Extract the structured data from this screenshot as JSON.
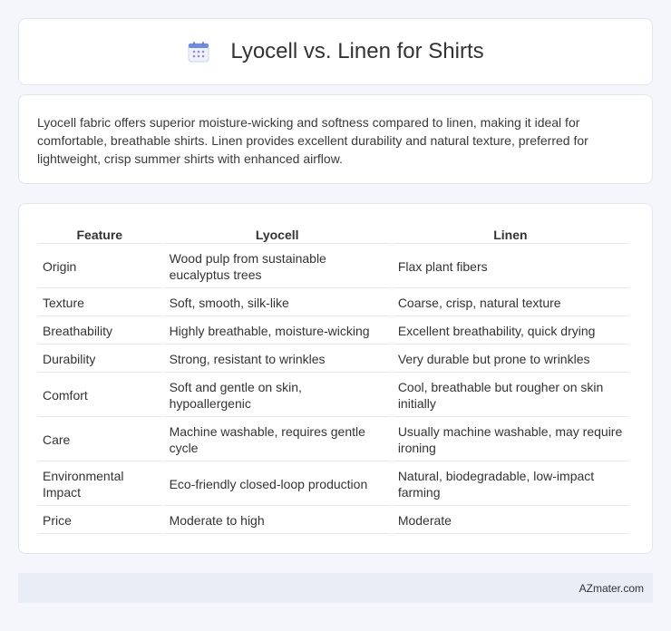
{
  "header": {
    "title": "Lyocell vs. Linen for Shirts",
    "icon": "calendar-icon"
  },
  "intro": {
    "text": "Lyocell fabric offers superior moisture-wicking and softness compared to linen, making it ideal for comfortable, breathable shirts. Linen provides excellent durability and natural texture, preferred for lightweight, crisp summer shirts with enhanced airflow."
  },
  "table": {
    "headers": [
      "Feature",
      "Lyocell",
      "Linen"
    ],
    "rows": [
      [
        "Origin",
        "Wood pulp from sustainable eucalyptus trees",
        "Flax plant fibers"
      ],
      [
        "Texture",
        "Soft, smooth, silk-like",
        "Coarse, crisp, natural texture"
      ],
      [
        "Breathability",
        "Highly breathable, moisture-wicking",
        "Excellent breathability, quick drying"
      ],
      [
        "Durability",
        "Strong, resistant to wrinkles",
        "Very durable but prone to wrinkles"
      ],
      [
        "Comfort",
        "Soft and gentle on skin, hypoallergenic",
        "Cool, breathable but rougher on skin initially"
      ],
      [
        "Care",
        "Machine washable, requires gentle cycle",
        "Usually machine washable, may require ironing"
      ],
      [
        "Environmental Impact",
        "Eco-friendly closed-loop production",
        "Natural, biodegradable, low-impact farming"
      ],
      [
        "Price",
        "Moderate to high",
        "Moderate"
      ]
    ]
  },
  "footer": {
    "credit": "AZmater.com"
  },
  "colors": {
    "background": "#f4f6fb",
    "card": "#ffffff",
    "footer": "#e8edf6",
    "icon_accent": "#5b8def"
  }
}
